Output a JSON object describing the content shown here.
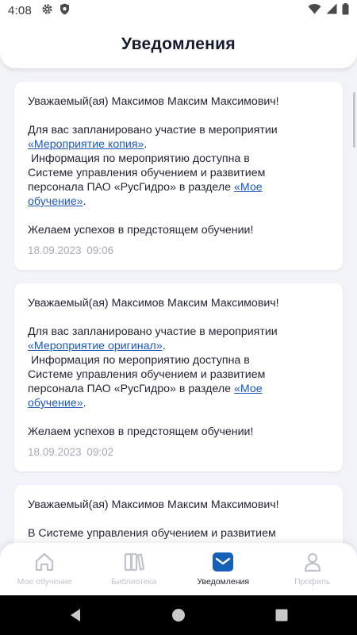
{
  "status_bar": {
    "time": "4:08",
    "icons_left": [
      "gear-icon",
      "shield-icon"
    ],
    "icons_right": [
      "wifi-icon",
      "signal-icon",
      "battery-icon"
    ]
  },
  "header": {
    "title": "Уведомления"
  },
  "notifications": [
    {
      "greeting": "Уважаемый(ая) Максимов Максим Максимович!",
      "line1": "Для вас запланировано участие в мероприятии",
      "event_link": "«Мероприятие копия»",
      "event_after": ".",
      "info_line1": " Информация по мероприятию доступна в",
      "info_line2": "Системе управления обучением и развитием",
      "info_line3_pre": "персонала ПАО «РусГидро» в разделе ",
      "section_link_1": "«Мое",
      "section_link_2": "обучение»",
      "section_after": ".",
      "wish": "Желаем успехов в предстоящем обучении!",
      "date": "18.09.2023 09:06"
    },
    {
      "greeting": "Уважаемый(ая) Максимов Максим Максимович!",
      "line1": "Для вас запланировано участие в мероприятии",
      "event_link": "«Мероприятие оригинал»",
      "event_after": ".",
      "info_line1": " Информация по мероприятию доступна в",
      "info_line2": "Системе управления обучением и развитием",
      "info_line3_pre": "персонала ПАО «РусГидро» в разделе ",
      "section_link_1": "«Мое",
      "section_link_2": "обучение»",
      "section_after": ".",
      "wish": "Желаем успехов в предстоящем обучении!",
      "date": "18.09.2023 09:02"
    },
    {
      "greeting": "Уважаемый(ая) Максимов Максим Максимович!",
      "line1": "В Системе управления обучением и развитием"
    }
  ],
  "bottom_nav": [
    {
      "label": "Мое обучение",
      "icon": "home-icon",
      "active": false
    },
    {
      "label": "Библиотека",
      "icon": "library-icon",
      "active": false
    },
    {
      "label": "Уведомления",
      "icon": "mail-icon",
      "active": true
    },
    {
      "label": "Профиль",
      "icon": "profile-icon",
      "active": false
    }
  ],
  "colors": {
    "background": "#f2f3f8",
    "link": "#1f57b5",
    "active_nav": "#1e2130",
    "active_nav_icon_bg": "#1760b8",
    "inactive_nav": "#c0c3cc",
    "date": "#a7aab4"
  }
}
